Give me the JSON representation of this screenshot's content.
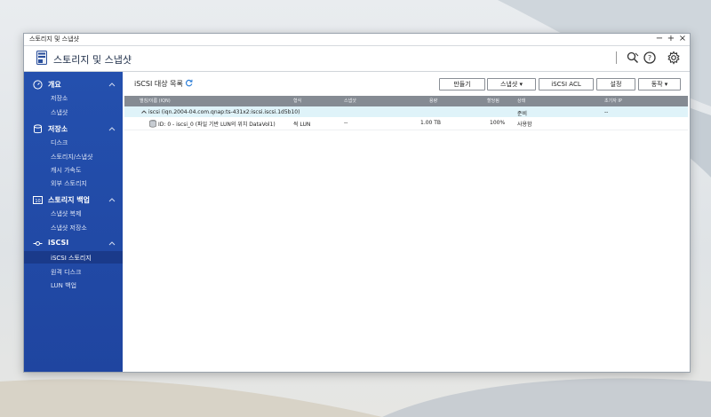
{
  "window": {
    "title": "스토리지 및 스냅샷"
  },
  "titlebar_controls": {
    "minimize": "−",
    "maximize": "+",
    "close": "×"
  },
  "header": {
    "app_title": "스토리지 및 스냅샷"
  },
  "sidebar": {
    "sections": [
      {
        "label": "개요",
        "items": [
          "저장소",
          "스냅샷"
        ]
      },
      {
        "label": "저장소",
        "items": [
          "디스크",
          "스토리지/스냅샷",
          "캐시 가속도",
          "외부 스토리지"
        ]
      },
      {
        "label": "스토리지 백업",
        "items": [
          "스냅샷 복제",
          "스냅샷 저장소"
        ]
      },
      {
        "label": "iSCSI",
        "items": [
          "iSCSI 스토리지",
          "원격 디스크",
          "LUN 백업"
        ]
      }
    ]
  },
  "main": {
    "title": "iSCSI 대상 목록",
    "buttons": {
      "create": "만들기",
      "snapshot": "스냅샷 ▾",
      "acl": "iSCSI ACL",
      "settings": "설정",
      "action": "동작 ▾"
    },
    "table": {
      "headers": [
        "별칭/이름 (IQN)",
        "형식",
        "스냅샷",
        "용량",
        "할당됨",
        "상태",
        "초기자 IP"
      ],
      "target_row": {
        "name": "iscsi (iqn.2004-04.com.qnap:ts-431x2:iscsi.iscsi.1d5b10)",
        "status": "준비",
        "initiator_ip": "--"
      },
      "lun_row": {
        "name": "ID: 0 - iscsi_0 (파일 기반 LUN의 위치 DataVol1)",
        "type": "씩 LUN",
        "snapshot": "--",
        "capacity": "1.00 TB",
        "allocated": "100%",
        "status": "사용함"
      }
    }
  }
}
